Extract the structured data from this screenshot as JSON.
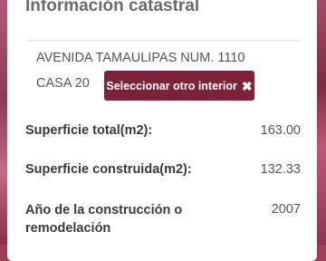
{
  "panel": {
    "title": "Información catastral"
  },
  "address": {
    "line1": "AVENIDA TAMAULIPAS NUM. 1110",
    "line2": "CASA 20"
  },
  "select_button": {
    "label": "Seleccionar otro interior",
    "icon": "close-icon",
    "color": "#7d2238"
  },
  "fields": [
    {
      "label": "Superficie total(m2):",
      "value": "163.00"
    },
    {
      "label": "Superficie construida(m2):",
      "value": "132.33"
    },
    {
      "label": "Año de la construcción o remodelación",
      "value": "2007"
    }
  ]
}
